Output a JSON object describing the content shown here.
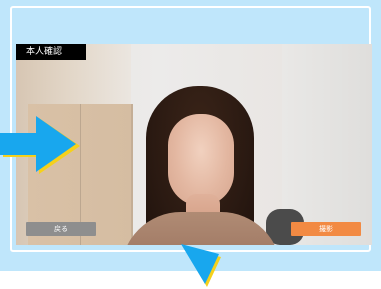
{
  "header": {
    "title": "本人確認"
  },
  "actions": {
    "back_label": "戻る",
    "capture_label": "撮影"
  },
  "colors": {
    "background": "#bfe6fb",
    "arrow_fill": "#18a7ee",
    "arrow_outline": "#f5d11b",
    "back_button": "#8e8e8e",
    "capture_button": "#f28a43"
  },
  "icons": {
    "pointer_left": "arrow-icon",
    "pointer_bottom": "arrow-icon"
  }
}
